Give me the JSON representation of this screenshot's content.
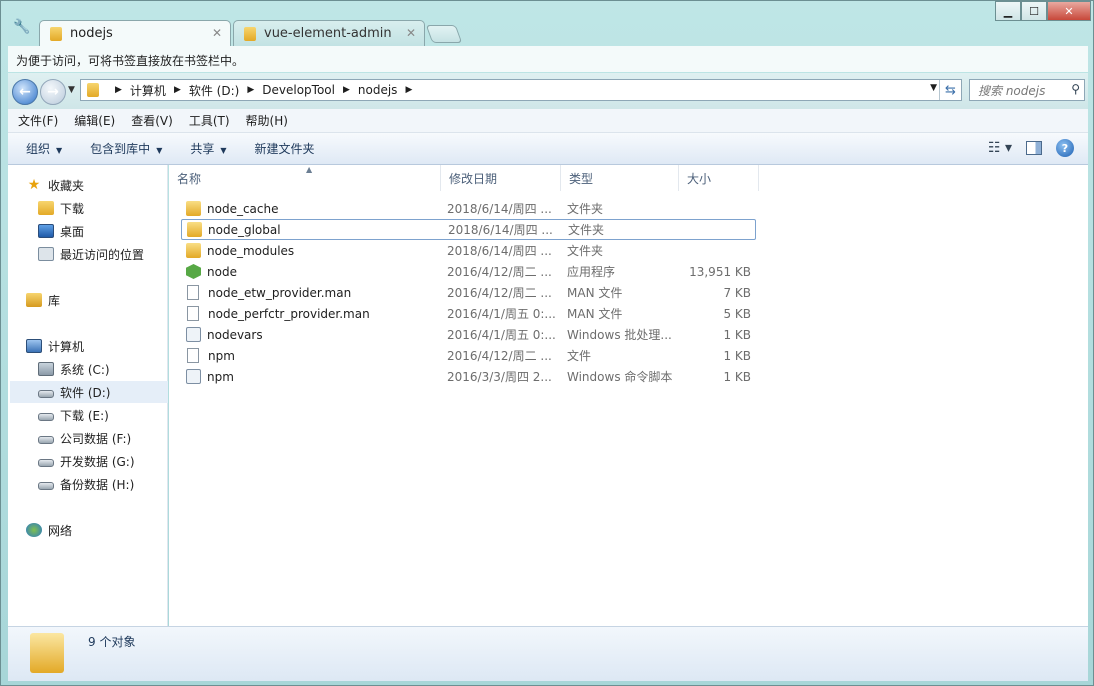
{
  "tabs": [
    {
      "label": "nodejs",
      "active": true
    },
    {
      "label": "vue-element-admin",
      "active": false
    }
  ],
  "bookmark_bar": "为便于访问，可将书签直接放在书签栏中。",
  "address": {
    "crumbs": [
      "计算机",
      "软件 (D:)",
      "DevelopTool",
      "nodejs"
    ],
    "search_placeholder": "搜索 nodejs"
  },
  "menu": [
    "文件(F)",
    "编辑(E)",
    "查看(V)",
    "工具(T)",
    "帮助(H)"
  ],
  "commands": [
    "组织",
    "包含到库中",
    "共享",
    "新建文件夹"
  ],
  "nav": {
    "favorites": "收藏夹",
    "downloads": "下载",
    "desktop": "桌面",
    "recent": "最近访问的位置",
    "library": "库",
    "computer": "计算机",
    "drives": [
      "系统 (C:)",
      "软件 (D:)",
      "下载 (E:)",
      "公司数据 (F:)",
      "开发数据 (G:)",
      "备份数据 (H:)"
    ],
    "network": "网络"
  },
  "columns": [
    "名称",
    "修改日期",
    "类型",
    "大小"
  ],
  "files": [
    {
      "name": "node_cache",
      "date": "2018/6/14/周四 ...",
      "type": "文件夹",
      "size": "",
      "icon": "folder-icon"
    },
    {
      "name": "node_global",
      "date": "2018/6/14/周四 ...",
      "type": "文件夹",
      "size": "",
      "icon": "folder-icon"
    },
    {
      "name": "node_modules",
      "date": "2018/6/14/周四 ...",
      "type": "文件夹",
      "size": "",
      "icon": "folder-icon"
    },
    {
      "name": "node",
      "date": "2016/4/12/周二 ...",
      "type": "应用程序",
      "size": "13,951 KB",
      "icon": "node-app-icon"
    },
    {
      "name": "node_etw_provider.man",
      "date": "2016/4/12/周二 ...",
      "type": "MAN 文件",
      "size": "7 KB",
      "icon": "file-icon"
    },
    {
      "name": "node_perfctr_provider.man",
      "date": "2016/4/1/周五 0:...",
      "type": "MAN 文件",
      "size": "5 KB",
      "icon": "file-icon"
    },
    {
      "name": "nodevars",
      "date": "2016/4/1/周五 0:...",
      "type": "Windows 批处理...",
      "size": "1 KB",
      "icon": "batch-icon"
    },
    {
      "name": "npm",
      "date": "2016/4/12/周二 ...",
      "type": "文件",
      "size": "1 KB",
      "icon": "file-icon"
    },
    {
      "name": "npm",
      "date": "2016/3/3/周四 2...",
      "type": "Windows 命令脚本",
      "size": "1 KB",
      "icon": "batch-icon"
    }
  ],
  "status": "9 个对象"
}
